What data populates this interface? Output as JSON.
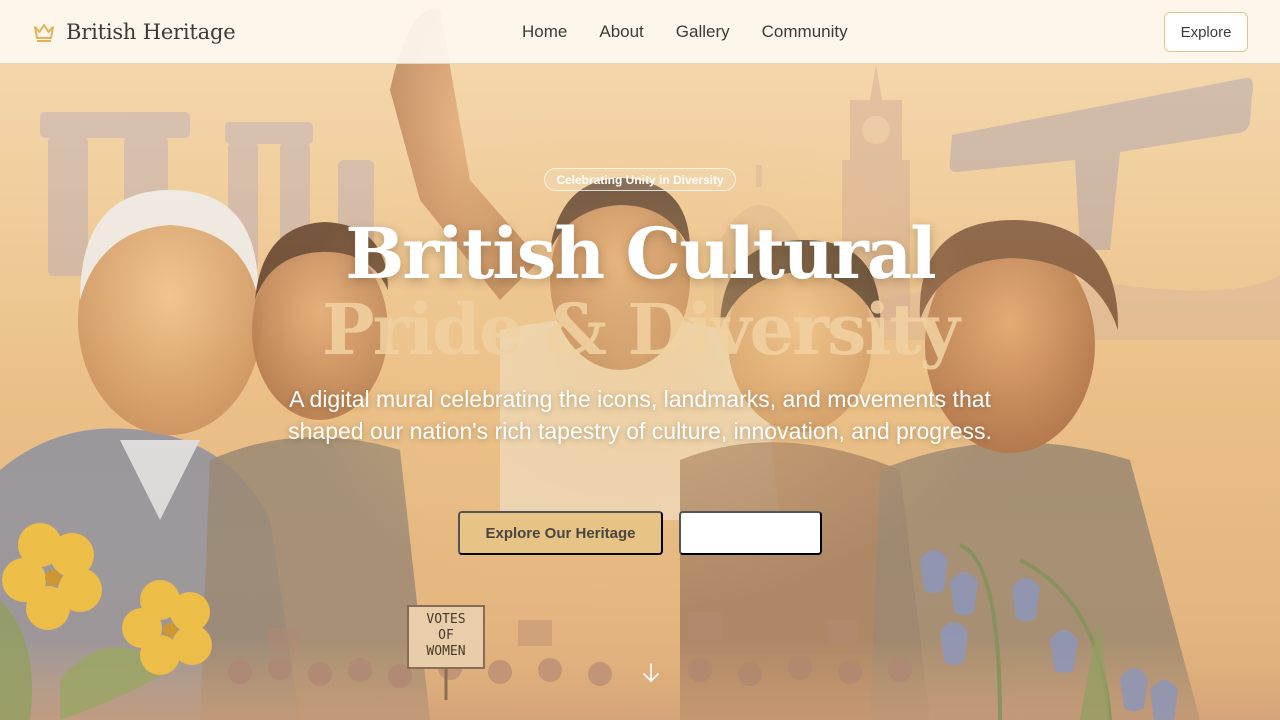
{
  "brand": {
    "name": "British Heritage",
    "icon": "crown-icon",
    "accent": "#e2b25a"
  },
  "nav": {
    "links": [
      "Home",
      "About",
      "Gallery",
      "Community"
    ],
    "cta_label": "Explore"
  },
  "hero": {
    "badge": "Celebrating Unity in Diversity",
    "title_line1": "British Cultural",
    "title_line2": "Pride & Diversity",
    "subtitle": "A digital mural celebrating the icons, landmarks, and movements that shaped our nation's rich tapestry of culture, innovation, and progress.",
    "primary_button": "Explore Our Heritage",
    "secondary_button": "",
    "scroll_icon": "arrow-down-icon"
  },
  "mural": {
    "protest_sign": "VOTES OF WOMEN"
  },
  "colors": {
    "button_primary": "#e7c486",
    "nav_background": "#fdf8f0",
    "text_dark": "#3f3a36"
  }
}
